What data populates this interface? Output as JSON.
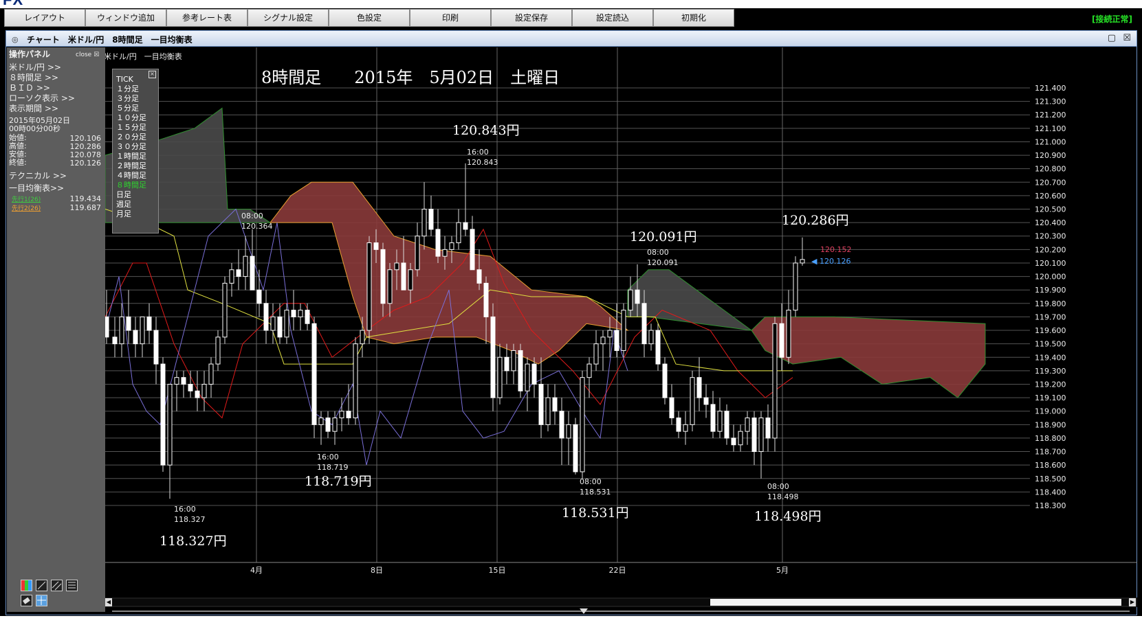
{
  "menu": {
    "items": [
      "レイアウト",
      "ウィンドウ追加",
      "参考レート表",
      "シグナル設定",
      "色設定",
      "印刷",
      "設定保存",
      "設定読込",
      "初期化"
    ],
    "status": "[接続正常]"
  },
  "window": {
    "title": "チャート　米ドル/円　8時間足　一目均衡表"
  },
  "panel": {
    "title": "操作パネル",
    "close_label": "close",
    "pair": "米ドル/円 >>",
    "timeframe": "８時間足 >>",
    "bid": "ＢＩＤ >>",
    "candle": "ローソク表示 >>",
    "period": "表示期間 >>",
    "date": "2015年05月02日",
    "time": "00時00分00秒",
    "ohlc": [
      {
        "label": "始値:",
        "value": "120.106"
      },
      {
        "label": "高値:",
        "value": "120.286"
      },
      {
        "label": "安値:",
        "value": "120.078"
      },
      {
        "label": "終値:",
        "value": "120.126"
      }
    ],
    "technical": "テクニカル >>",
    "ichimoku": "一目均衡表>>",
    "span1_label": "先行1(26)",
    "span1_value": "119.434",
    "span2_label": "先行2(26)",
    "span2_value": "119.687"
  },
  "timeframes": [
    "TICK",
    "１分足",
    "３分足",
    "５分足",
    "１０分足",
    "１５分足",
    "２０分足",
    "３０分足",
    "１時間足",
    "２時間足",
    "４時間足",
    "８時間足",
    "日足",
    "週足",
    "月足"
  ],
  "timeframe_selected": 11,
  "chart": {
    "legend": "米ドル/円　一目均衡表",
    "heading": "8時間足　　2015年　5月02日　土曜日",
    "last_red": "120.152",
    "last_blue": "◀ 120.126",
    "annotations": [
      {
        "time": "16:00",
        "value": "118.327",
        "big": "118.327円"
      },
      {
        "time": "08:00",
        "value": "120.364",
        "big": ""
      },
      {
        "time": "16:00",
        "value": "118.719",
        "big": "118.719円"
      },
      {
        "time": "16:00",
        "value": "120.843",
        "big": "120.843円"
      },
      {
        "time": "08:00",
        "value": "118.531",
        "big": "118.531円"
      },
      {
        "time": "08:00",
        "value": "120.091",
        "big": "120.091円"
      },
      {
        "time": "08:00",
        "value": "118.498",
        "big": "118.498円"
      },
      {
        "time": "",
        "value": "",
        "big": "120.286円"
      }
    ],
    "x_labels": [
      "4月",
      "8日",
      "15日",
      "22日",
      "5月"
    ]
  },
  "chart_data": {
    "type": "line",
    "ylim": [
      118.3,
      121.4
    ],
    "y_ticks": [
      "121.400",
      "121.300",
      "121.200",
      "121.100",
      "121.000",
      "120.900",
      "120.800",
      "120.700",
      "120.600",
      "120.500",
      "120.400",
      "120.300",
      "120.200",
      "120.100",
      "120.000",
      "119.900",
      "119.800",
      "119.700",
      "119.600",
      "119.500",
      "119.400",
      "119.300",
      "119.200",
      "119.100",
      "119.000",
      "118.900",
      "118.800",
      "118.700",
      "118.600",
      "118.500",
      "118.400",
      "118.300"
    ],
    "series": [
      {
        "name": "先行1(26)",
        "last": 119.434
      },
      {
        "name": "先行2(26)",
        "last": 119.687
      }
    ],
    "colors": {
      "candle_up": "#ffffff",
      "candle_down": "#ffffff",
      "tenkan": "#e01a1a",
      "kijun": "#e0e040",
      "chikou": "#7a6fd8",
      "kumo_bear": "#8a3a3a",
      "kumo_bull": "#4a4a4a",
      "span1": "#2f8f2f",
      "span2": "#e8a030",
      "last_red": "#e04060",
      "last_blue": "#4aa0ff"
    }
  }
}
